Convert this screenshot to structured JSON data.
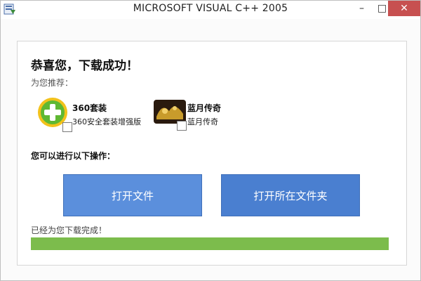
{
  "window": {
    "title": "MICROSOFT VISUAL C++ 2005",
    "app_icon": "installer-icon",
    "controls": {
      "minimize": "–",
      "maximize": "□",
      "close": "✕"
    }
  },
  "content": {
    "heading": "恭喜您，下载成功！",
    "recommend_label": "为您推荐：",
    "recommendations": [
      {
        "title": "360套装",
        "subtitle": "360安全套装增强版",
        "icon": "360-logo-icon",
        "checked": false
      },
      {
        "title": "蓝月传奇",
        "subtitle": "蓝月传奇",
        "icon": "game-logo-icon",
        "checked": false
      }
    ],
    "ops_label": "您可以进行以下操作：",
    "buttons": {
      "open_file": "打开文件",
      "open_folder": "打开所在文件夹"
    },
    "status_text": "已经为您下载完成！",
    "progress_fraction": 1.0
  },
  "colors": {
    "button_primary": "#5b8fdc",
    "progress_green": "#7cbc4c",
    "close_red": "#c75050"
  }
}
